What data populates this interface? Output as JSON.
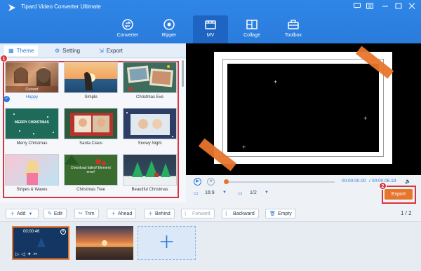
{
  "app": {
    "title": "Tipard Video Converter Ultimate"
  },
  "nav": [
    {
      "label": "Converter",
      "icon": "converter-icon"
    },
    {
      "label": "Ripper",
      "icon": "ripper-icon"
    },
    {
      "label": "MV",
      "icon": "mv-icon",
      "active": true
    },
    {
      "label": "Collage",
      "icon": "collage-icon"
    },
    {
      "label": "Toolbox",
      "icon": "toolbox-icon"
    }
  ],
  "tabs": [
    {
      "label": "Theme",
      "active": true
    },
    {
      "label": "Setting"
    },
    {
      "label": "Export"
    }
  ],
  "themes": [
    {
      "name": "Happy",
      "overlay": "Current",
      "selected": true
    },
    {
      "name": "Simple"
    },
    {
      "name": "Christmas Eve"
    },
    {
      "name": "Merry Christmas",
      "overlay": "MERRY CHRISTMAS"
    },
    {
      "name": "Santa Claus"
    },
    {
      "name": "Snowy Night"
    },
    {
      "name": "Stripes & Waves"
    },
    {
      "name": "Christmas Tree",
      "overlay": "Download failed! Element error!"
    },
    {
      "name": "Beautiful Christmas"
    }
  ],
  "callouts": {
    "one": "1",
    "two": "2"
  },
  "player": {
    "time_current": "00:00:00.00",
    "time_total": "00:00:06.19",
    "time_sep": "/",
    "aspect": "16:9",
    "screen": "1/2",
    "progress": 0.0,
    "export_label": "Export"
  },
  "toolbar": {
    "add": "Add",
    "edit": "Edit",
    "trim": "Trim",
    "ahead": "Ahead",
    "behind": "Behind",
    "forward": "Forward",
    "backward": "Backward",
    "empty": "Empty",
    "page": "1 / 2"
  },
  "clips": [
    {
      "time": "00:00:46",
      "selected": true
    },
    {
      "time": ""
    }
  ],
  "colors": {
    "accent": "#2a7bdc",
    "orange": "#e8752c",
    "red": "#d9343d"
  }
}
